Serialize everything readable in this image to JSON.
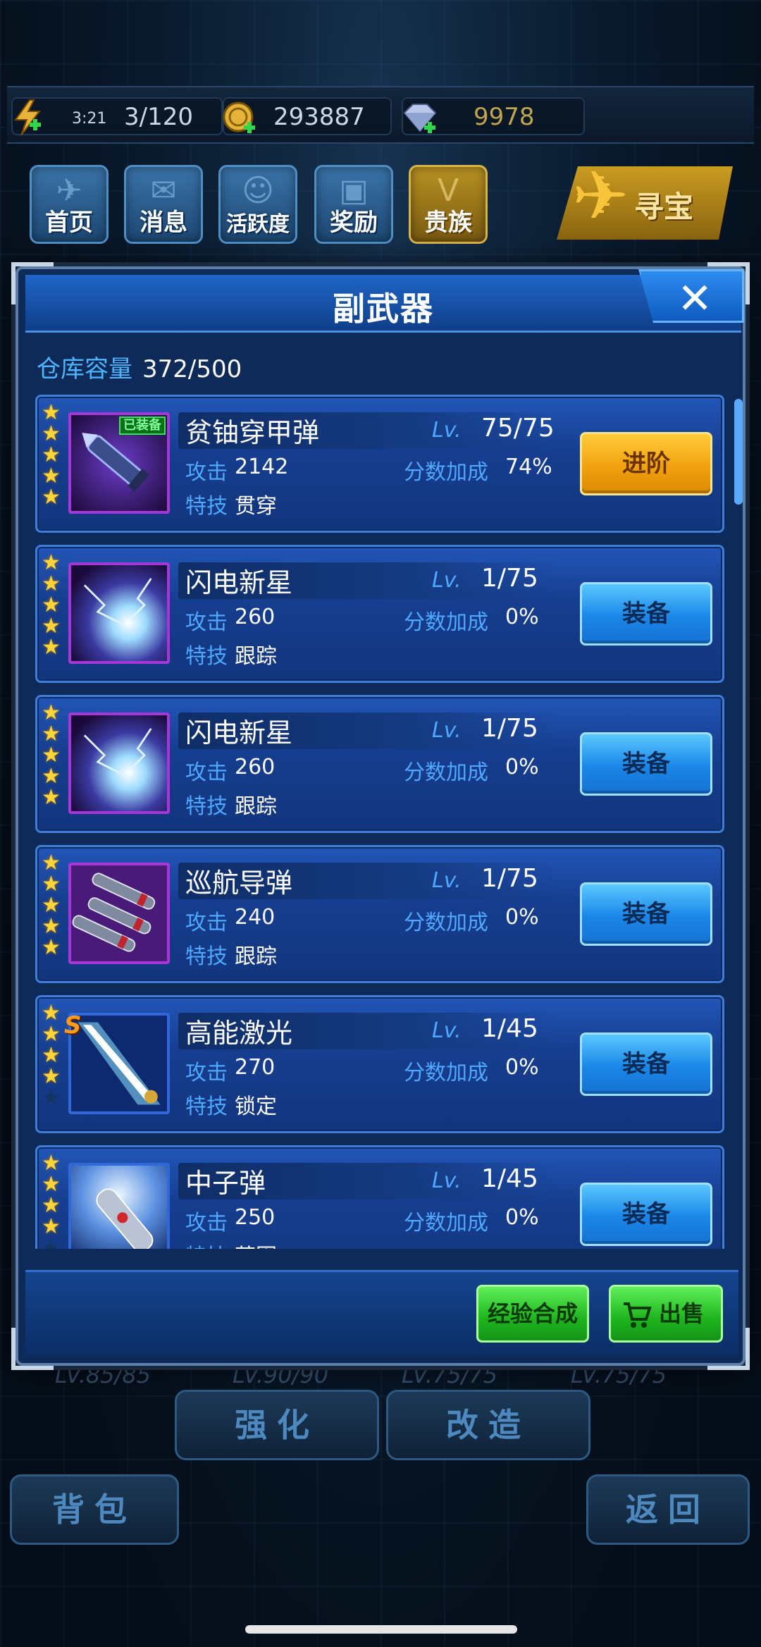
{
  "resources": {
    "energy_time": "3:21",
    "energy": "3/120",
    "coins": "293887",
    "gems": "9978"
  },
  "nav": [
    {
      "label": "首页",
      "icon": "plane-icon"
    },
    {
      "label": "消息",
      "icon": "mail-icon"
    },
    {
      "label": "活跃度",
      "icon": "face-badge-icon"
    },
    {
      "label": "奖励",
      "icon": "gift-icon"
    },
    {
      "label": "贵族",
      "icon": "vip-badge-icon"
    }
  ],
  "treasure_label": "寻宝",
  "modal": {
    "title": "副武器",
    "capacity_label": "仓库容量",
    "capacity_value": "372/500",
    "lv_label": "Lv.",
    "attack_label": "攻击",
    "bonus_label": "分数加成",
    "skill_label": "特技",
    "items": [
      {
        "name": "贫铀穿甲弹",
        "stars": 5,
        "level": "75/75",
        "attack": "2142",
        "bonus": "74%",
        "skill": "贯穿",
        "equipped_tag": "已装备",
        "action": "进阶",
        "art": "missile-purple"
      },
      {
        "name": "闪电新星",
        "stars": 5,
        "level": "1/75",
        "attack": "260",
        "bonus": "0%",
        "skill": "跟踪",
        "action": "装备",
        "art": "lightning"
      },
      {
        "name": "闪电新星",
        "stars": 5,
        "level": "1/75",
        "attack": "260",
        "bonus": "0%",
        "skill": "跟踪",
        "action": "装备",
        "art": "lightning"
      },
      {
        "name": "巡航导弹",
        "stars": 5,
        "level": "1/75",
        "attack": "240",
        "bonus": "0%",
        "skill": "跟踪",
        "action": "装备",
        "art": "cruise"
      },
      {
        "name": "高能激光",
        "stars": 4,
        "level": "1/45",
        "attack": "270",
        "bonus": "0%",
        "skill": "锁定",
        "action": "装备",
        "badge": "S",
        "art": "laser"
      },
      {
        "name": "中子弹",
        "stars": 4,
        "level": "1/45",
        "attack": "250",
        "bonus": "0%",
        "skill": "范围",
        "action": "装备",
        "art": "neutron"
      }
    ],
    "exp_merge_label": "经验合成",
    "sell_label": "出售"
  },
  "bottom": {
    "stats": [
      "LV.85/85",
      "LV.90/90",
      "LV.75/75",
      "LV.75/75"
    ],
    "enhance": "强化",
    "modify": "改造",
    "backpack": "背包",
    "back": "返回"
  },
  "colors": {
    "accent_blue": "#4fa8ff",
    "gold_button": "#f2a10f",
    "green_button": "#1eb41c",
    "star": "#ffd43a"
  }
}
